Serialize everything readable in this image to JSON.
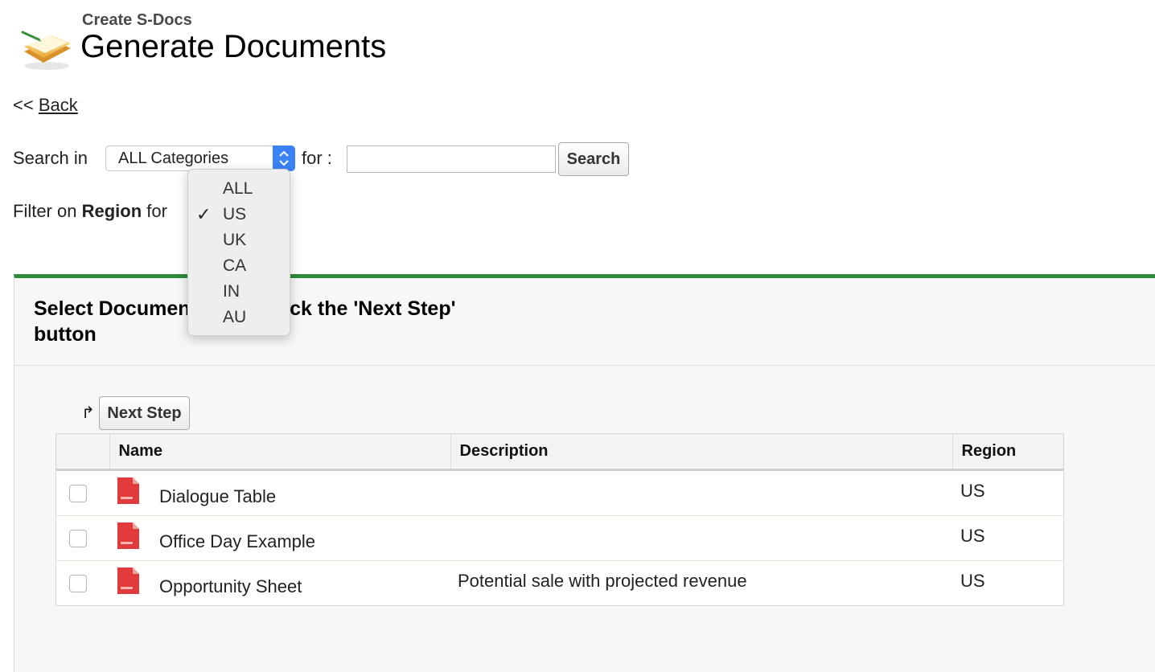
{
  "header": {
    "subtitle": "Create S-Docs",
    "title": "Generate Documents",
    "logo_icon": "folder-document-icon"
  },
  "nav": {
    "back_prefix": "<<",
    "back_label": "Back"
  },
  "search": {
    "label": "Search in",
    "category_value": "ALL Categories",
    "for_label": "for :",
    "input_value": "",
    "button_label": "Search"
  },
  "filter": {
    "label_prefix": "Filter on",
    "label_field": "Region",
    "label_suffix": "for",
    "dropdown_options": [
      "ALL",
      "US",
      "UK",
      "CA",
      "IN",
      "AU"
    ],
    "selected_option": "US"
  },
  "panel": {
    "title": "Select Documents, then click the 'Next Step' button",
    "accent_color": "#2f8a3e",
    "next_button_label": "Next Step"
  },
  "table": {
    "columns": [
      "",
      "Name",
      "Description",
      "Region"
    ],
    "rows": [
      {
        "name": "Dialogue Table",
        "description": "",
        "region": "US",
        "icon": "pdf-file-icon"
      },
      {
        "name": "Office Day Example",
        "description": "",
        "region": "US",
        "icon": "pdf-file-icon"
      },
      {
        "name": "Opportunity Sheet",
        "description": "Potential sale with projected revenue",
        "region": "US",
        "icon": "pdf-file-icon"
      }
    ]
  }
}
